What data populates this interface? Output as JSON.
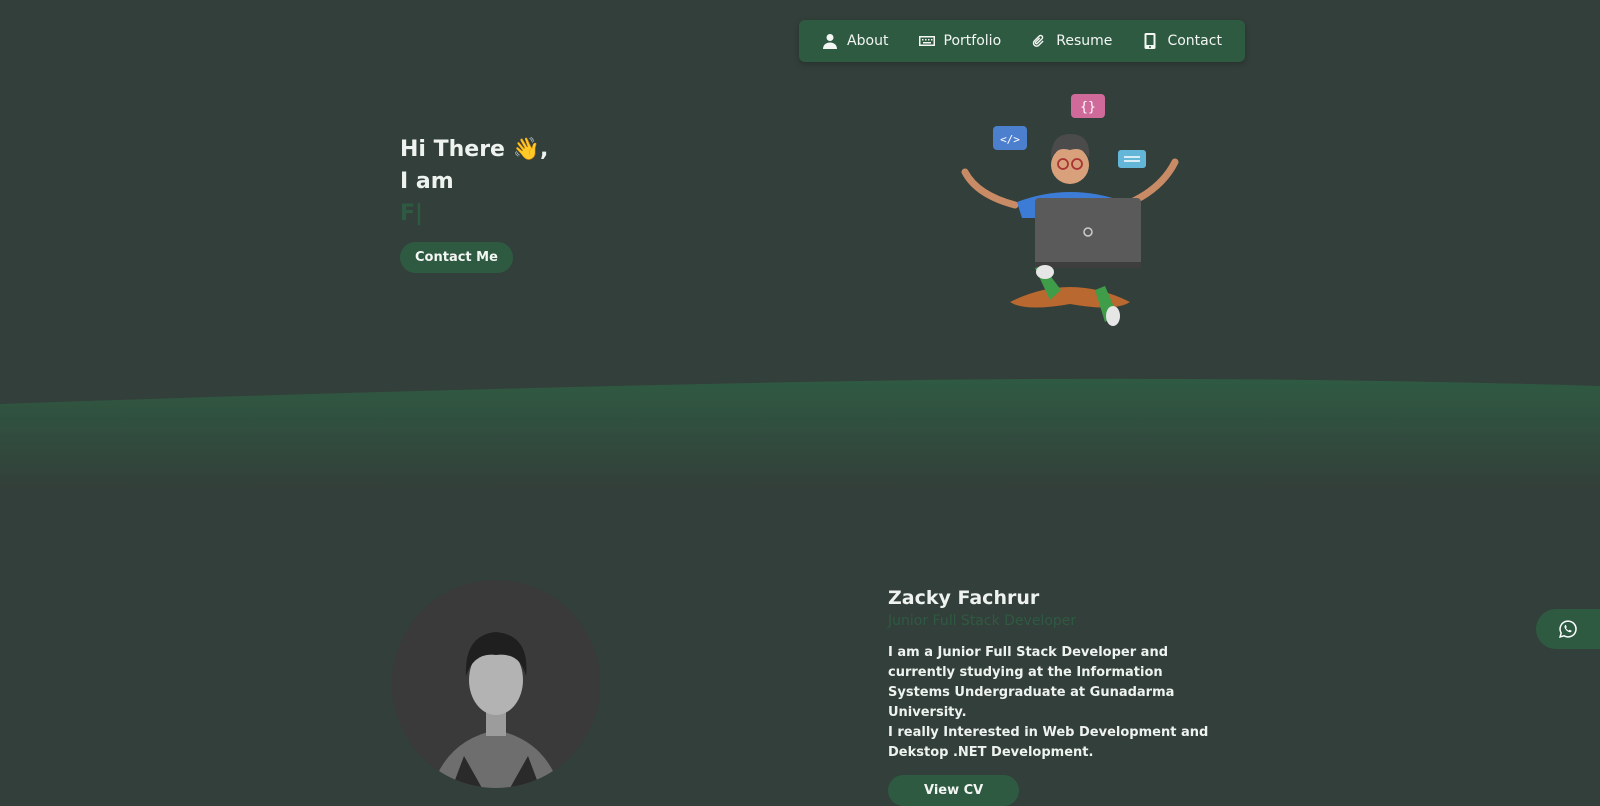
{
  "nav": {
    "items": [
      {
        "label": "About",
        "icon": "user-icon"
      },
      {
        "label": "Portfolio",
        "icon": "keyboard-icon"
      },
      {
        "label": "Resume",
        "icon": "paperclip-icon"
      },
      {
        "label": "Contact",
        "icon": "mobile-phone-icon"
      }
    ]
  },
  "hero": {
    "greeting": "Hi There 👋,",
    "intro": "I am",
    "typed_text": "F|",
    "button_label": "Contact Me"
  },
  "about": {
    "name": "Zacky Fachrur",
    "role": "Junior Full Stack Developer",
    "description_1": "I am a Junior Full Stack Developer and currently studying at the Information Systems Undergraduate at Gunadarma University.",
    "description_2": "I really Interested in Web Development and Dekstop .NET Development.",
    "button_label": "View CV"
  },
  "floating": {
    "icon": "whatsapp-icon"
  },
  "colors": {
    "background": "#333f3a",
    "accent": "#2f5a42",
    "text": "#eef3ef"
  }
}
